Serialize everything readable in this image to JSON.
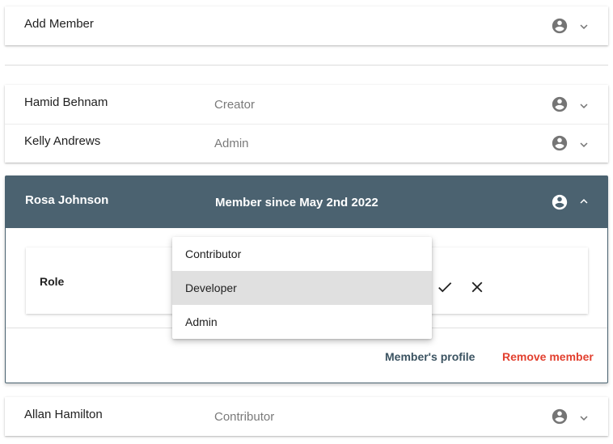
{
  "add_member": {
    "label": "Add Member"
  },
  "members": [
    {
      "name": "Hamid Behnam",
      "role": "Creator"
    },
    {
      "name": "Kelly Andrews",
      "role": "Admin"
    }
  ],
  "expanded_member": {
    "name": "Rosa Johnson",
    "since": "Member since May 2nd 2022",
    "role_label": "Role",
    "profile_link": "Member's profile",
    "remove_link": "Remove member"
  },
  "role_dropdown": {
    "options": [
      "Contributor",
      "Developer",
      "Admin"
    ],
    "highlighted": "Developer"
  },
  "last_member": {
    "name": "Allan Hamilton",
    "role": "Contributor"
  },
  "colors": {
    "header_bg": "#4b6270",
    "remove_red": "#e2402f",
    "profile_link": "#3b5361",
    "icon_gray": "#757575"
  },
  "icons": {
    "avatar": "account-circle-icon",
    "expand": "chevron-down-icon",
    "collapse": "chevron-up-icon",
    "confirm": "check-icon",
    "cancel": "close-icon"
  }
}
